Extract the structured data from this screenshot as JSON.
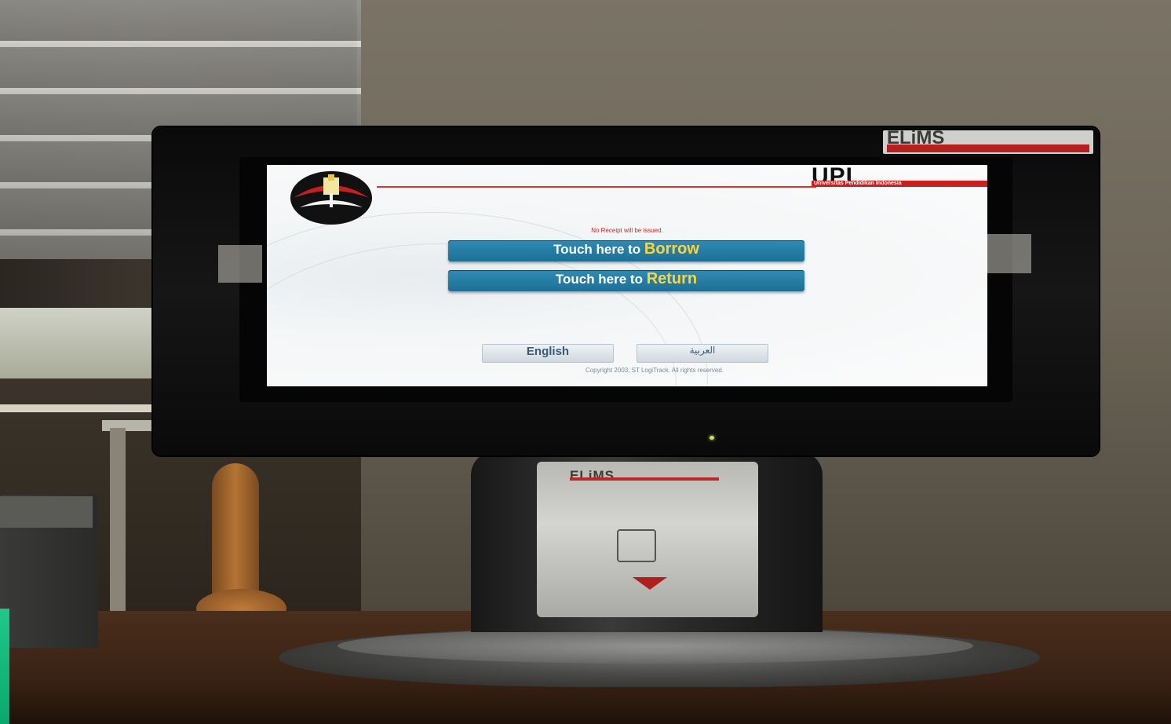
{
  "kiosk_screen": {
    "institution_name": "UPI",
    "institution_subtitle": "Universitas Pendidikan Indonesia",
    "notice": "No Receipt will be issued.",
    "borrow_button": {
      "prefix": "Touch here to ",
      "action": "Borrow"
    },
    "return_button": {
      "prefix": "Touch here to ",
      "action": "Return"
    },
    "language_english": "English",
    "language_arabic": "العربية",
    "copyright": "Copyright 2003, ST LogiTrack. All rights reserved."
  },
  "hardware": {
    "monitor_badge": "ELiMS",
    "scanner_brand": "ELiMS"
  },
  "colors": {
    "button_blue": "#2f8bb4",
    "button_highlight": "#ffd43a",
    "brand_red": "#cc1f1f"
  }
}
